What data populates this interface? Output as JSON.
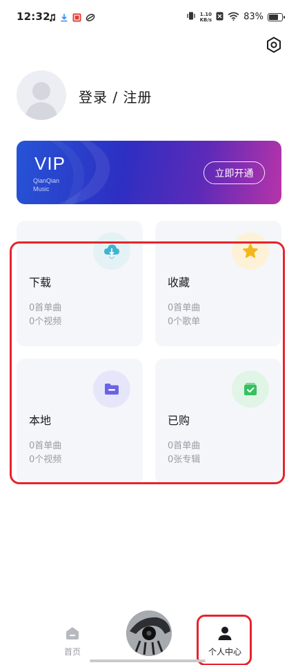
{
  "status_bar": {
    "time": "12:32",
    "notif_icons": [
      "music-note-icon",
      "download-icon",
      "app-badge-icon",
      "link-icon"
    ],
    "net_speed_value": "1.10",
    "net_speed_unit": "KB/s",
    "battery_percent_text": "83%",
    "battery_level": 0.83
  },
  "profile": {
    "login_text": "登录 / 注册"
  },
  "vip": {
    "title": "VIP",
    "sub_line1": "QianQian",
    "sub_line2": "Music",
    "open_button": "立即开通"
  },
  "cards": [
    {
      "id": "download",
      "title": "下载",
      "line1": "0首单曲",
      "line2": "0个视频",
      "icon": "cloud-download-icon",
      "icon_bg": "#e4f2f6",
      "icon_color": "#3fb3cf"
    },
    {
      "id": "favorite",
      "title": "收藏",
      "line1": "0首单曲",
      "line2": "0个歌单",
      "icon": "star-icon",
      "icon_bg": "#fdf1d8",
      "icon_color": "#f5b61a"
    },
    {
      "id": "local",
      "title": "本地",
      "line1": "0首单曲",
      "line2": "0个视频",
      "icon": "folder-icon",
      "icon_bg": "#e6e6fb",
      "icon_color": "#6a63e6"
    },
    {
      "id": "purchased",
      "title": "已购",
      "line1": "0首单曲",
      "line2": "0张专辑",
      "icon": "shopping-bag-check-icon",
      "icon_bg": "#e1f5e7",
      "icon_color": "#36c060"
    }
  ],
  "bottom_nav": {
    "home_label": "首页",
    "profile_label": "个人中心"
  },
  "colors": {
    "highlight": "#e5232b",
    "card_bg": "#f5f6fa",
    "muted_text": "#9a9ca4"
  }
}
